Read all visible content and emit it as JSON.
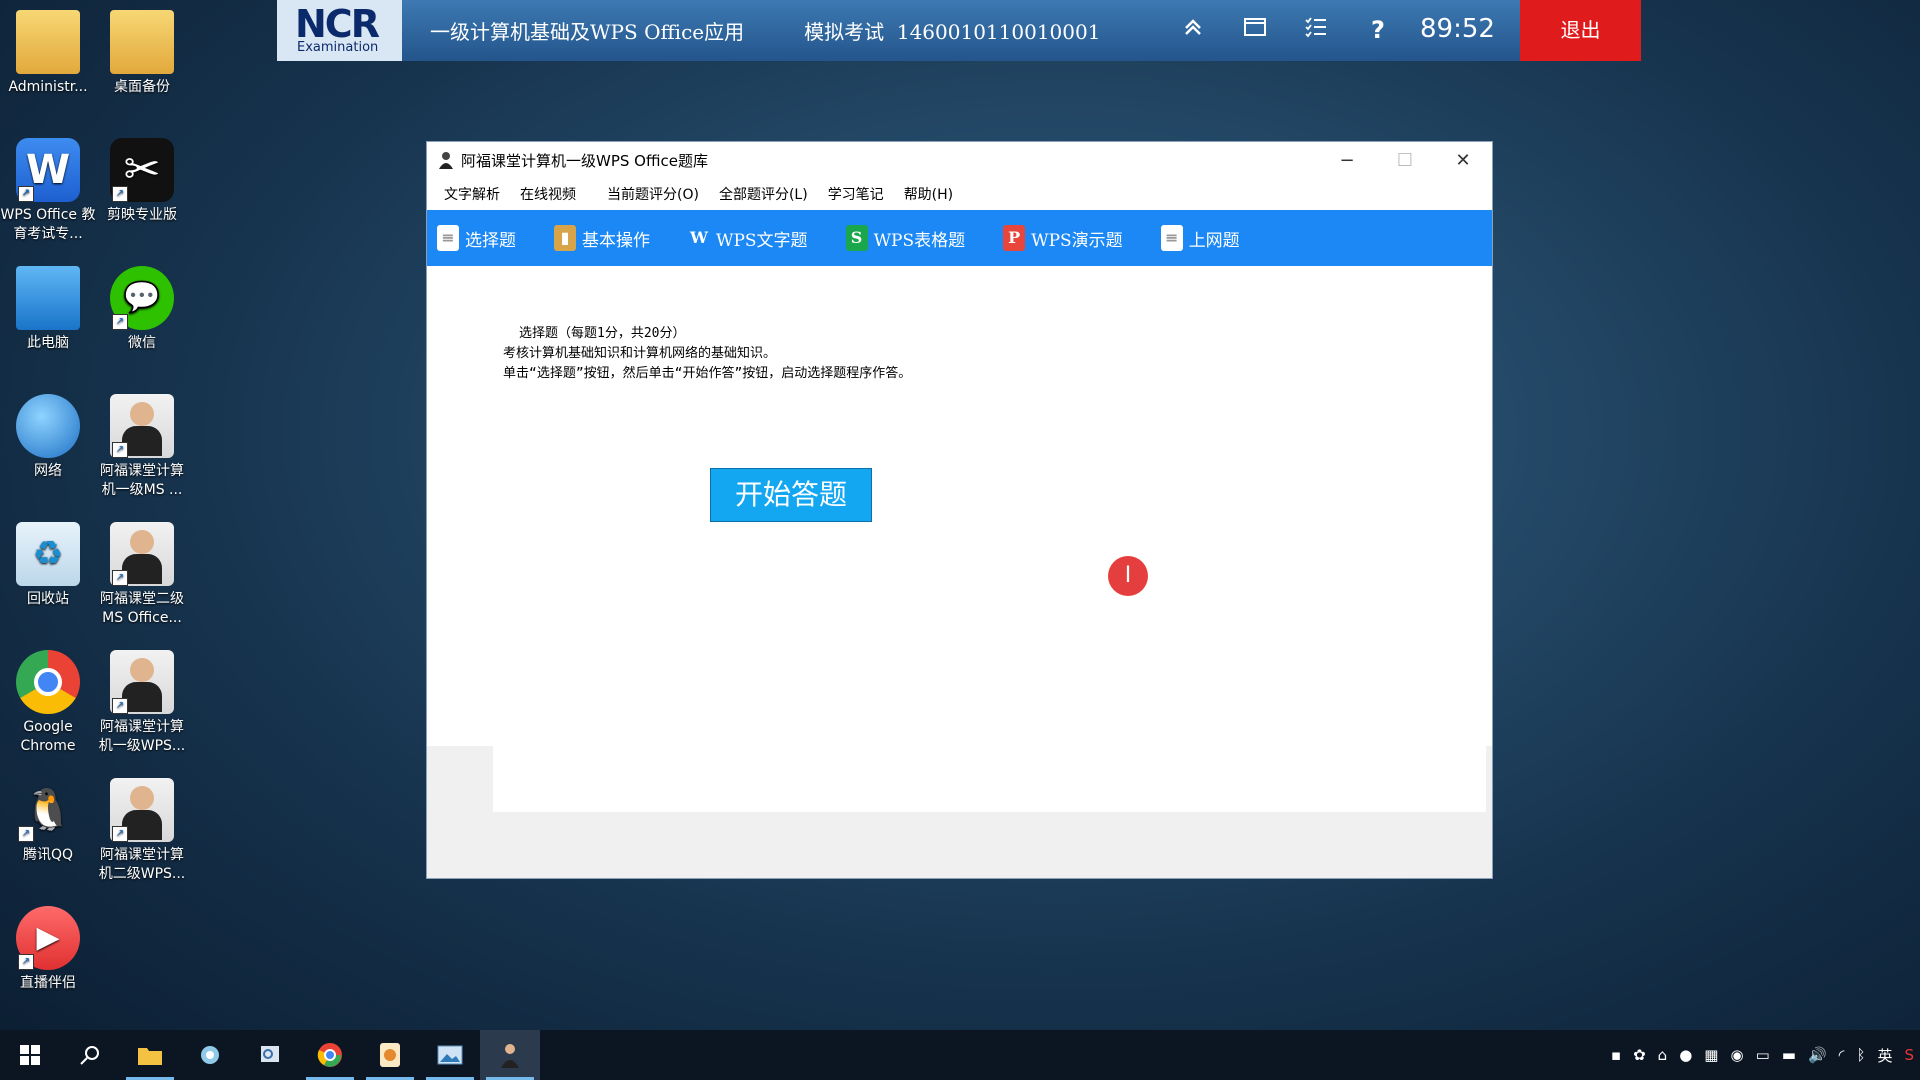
{
  "desktop": {
    "icons": [
      {
        "label": "Administr...",
        "glyph": ""
      },
      {
        "label": "桌面备份",
        "glyph": ""
      },
      {
        "label": "WPS Office 教育考试专...",
        "glyph": "W"
      },
      {
        "label": "剪映专业版",
        "glyph": "✂"
      },
      {
        "label": "此电脑",
        "glyph": ""
      },
      {
        "label": "微信",
        "glyph": "💬"
      },
      {
        "label": "网络",
        "glyph": ""
      },
      {
        "label": "阿福课堂计算机一级MS ...",
        "glyph": ""
      },
      {
        "label": "回收站",
        "glyph": "♻"
      },
      {
        "label": "阿福课堂二级MS Office...",
        "glyph": ""
      },
      {
        "label": "Google Chrome",
        "glyph": ""
      },
      {
        "label": "阿福课堂计算机一级WPS...",
        "glyph": ""
      },
      {
        "label": "腾讯QQ",
        "glyph": "🐧"
      },
      {
        "label": "阿福课堂计算机二级WPS...",
        "glyph": ""
      },
      {
        "label": "直播伴侣",
        "glyph": "▶"
      }
    ]
  },
  "exam_bar": {
    "logo_text": "NCR",
    "logo_sub": "Examination",
    "title": "一级计算机基础及WPS Office应用",
    "mode": "模拟考试",
    "candidate_id": "1460010110010001",
    "timer": "89:52",
    "exit_label": "退出",
    "icons": [
      "collapse-icon",
      "window-icon",
      "list-icon",
      "help-icon"
    ],
    "help_glyph": "?"
  },
  "window": {
    "title": "阿福课堂计算机一级WPS Office题库",
    "controls": {
      "minimize": "−",
      "maximize": "☐",
      "close": "✕"
    },
    "menu": [
      "文字解析",
      "在线视频",
      "当前题评分(O)",
      "全部题评分(L)",
      "学习笔记",
      "帮助(H)"
    ],
    "toolbar": [
      {
        "label": "选择题",
        "glyph": "≡"
      },
      {
        "label": "基本操作",
        "glyph": "▮"
      },
      {
        "label": "WPS文字题",
        "glyph": "W"
      },
      {
        "label": "WPS表格题",
        "glyph": "S"
      },
      {
        "label": "WPS演示题",
        "glyph": "P"
      },
      {
        "label": "上网题",
        "glyph": "≡"
      }
    ],
    "intro": {
      "line1": "选择题（每题1分，共20分）",
      "line2": "考核计算机基础知识和计算机网络的基础知识。",
      "line3": "单击“选择题”按钮，然后单击“开始作答”按钮，启动选择题程序作答。"
    },
    "start_button": "开始答题",
    "cursor_glyph": "I"
  },
  "taskbar": {
    "items": [
      "start-icon",
      "search-icon",
      "file-explorer-icon",
      "settings-icon",
      "notepad-icon",
      "chrome-icon",
      "wps-icon",
      "image-viewer-icon",
      "afu-app-icon"
    ],
    "ime": "英"
  }
}
